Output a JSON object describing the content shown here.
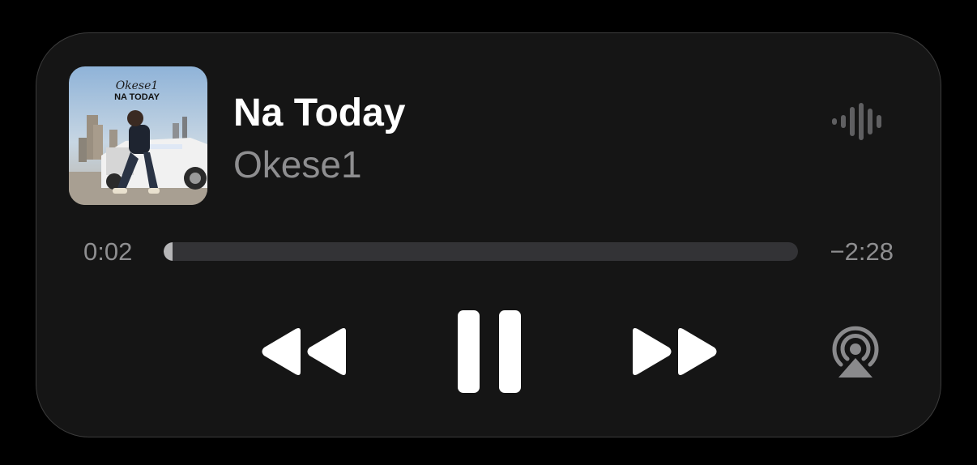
{
  "now_playing": {
    "artwork": {
      "artist_text": "Okese1",
      "title_text": "NA TODAY"
    },
    "title": "Na Today",
    "artist": "Okese1"
  },
  "progress": {
    "elapsed": "0:02",
    "remaining": "−2:28",
    "fraction": 0.013
  },
  "controls": {
    "rewind_icon": "rewind-icon",
    "pause_icon": "pause-icon",
    "forward_icon": "fast-forward-icon",
    "airplay_icon": "airplay-audio-icon",
    "waveform_icon": "waveform-icon"
  },
  "colors": {
    "background": "#151515",
    "primary_text": "#ffffff",
    "secondary_text": "#8e8e90",
    "track": "#333336",
    "track_fill": "#b6b6b8"
  }
}
